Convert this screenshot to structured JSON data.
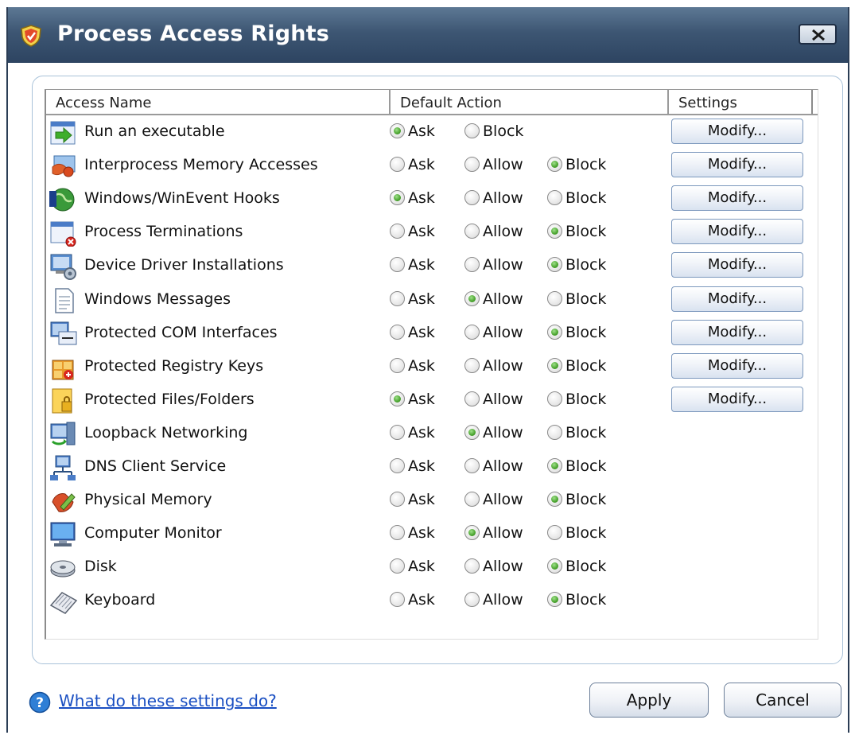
{
  "window": {
    "title": "Process Access Rights"
  },
  "table": {
    "headers": {
      "name": "Access Name",
      "action": "Default Action",
      "settings": "Settings"
    },
    "labels": {
      "ask": "Ask",
      "allow": "Allow",
      "block": "Block",
      "modify": "Modify..."
    },
    "rows": [
      {
        "name": "Run an executable",
        "icon": "run-executable-icon",
        "options": [
          "Ask",
          "Block"
        ],
        "selected": "Ask",
        "modify": true
      },
      {
        "name": "Interprocess Memory Accesses",
        "icon": "interprocess-memory-icon",
        "options": [
          "Ask",
          "Allow",
          "Block"
        ],
        "selected": "Block",
        "modify": true
      },
      {
        "name": "Windows/WinEvent Hooks",
        "icon": "hooks-icon",
        "options": [
          "Ask",
          "Allow",
          "Block"
        ],
        "selected": "Ask",
        "modify": true
      },
      {
        "name": "Process Terminations",
        "icon": "process-termination-icon",
        "options": [
          "Ask",
          "Allow",
          "Block"
        ],
        "selected": "Block",
        "modify": true
      },
      {
        "name": "Device Driver Installations",
        "icon": "device-driver-icon",
        "options": [
          "Ask",
          "Allow",
          "Block"
        ],
        "selected": "Block",
        "modify": true
      },
      {
        "name": "Windows Messages",
        "icon": "windows-messages-icon",
        "options": [
          "Ask",
          "Allow",
          "Block"
        ],
        "selected": "Allow",
        "modify": true
      },
      {
        "name": "Protected COM Interfaces",
        "icon": "com-interfaces-icon",
        "options": [
          "Ask",
          "Allow",
          "Block"
        ],
        "selected": "Block",
        "modify": true
      },
      {
        "name": "Protected Registry Keys",
        "icon": "registry-keys-icon",
        "options": [
          "Ask",
          "Allow",
          "Block"
        ],
        "selected": "Block",
        "modify": true
      },
      {
        "name": "Protected Files/Folders",
        "icon": "files-folders-icon",
        "options": [
          "Ask",
          "Allow",
          "Block"
        ],
        "selected": "Ask",
        "modify": true
      },
      {
        "name": "Loopback Networking",
        "icon": "loopback-networking-icon",
        "options": [
          "Ask",
          "Allow",
          "Block"
        ],
        "selected": "Allow",
        "modify": false
      },
      {
        "name": "DNS Client Service",
        "icon": "dns-client-icon",
        "options": [
          "Ask",
          "Allow",
          "Block"
        ],
        "selected": "Block",
        "modify": false
      },
      {
        "name": "Physical Memory",
        "icon": "physical-memory-icon",
        "options": [
          "Ask",
          "Allow",
          "Block"
        ],
        "selected": "Block",
        "modify": false
      },
      {
        "name": "Computer Monitor",
        "icon": "computer-monitor-icon",
        "options": [
          "Ask",
          "Allow",
          "Block"
        ],
        "selected": "Allow",
        "modify": false
      },
      {
        "name": "Disk",
        "icon": "disk-icon",
        "options": [
          "Ask",
          "Allow",
          "Block"
        ],
        "selected": "Block",
        "modify": false
      },
      {
        "name": "Keyboard",
        "icon": "keyboard-icon",
        "options": [
          "Ask",
          "Allow",
          "Block"
        ],
        "selected": "Block",
        "modify": false
      }
    ]
  },
  "footer": {
    "help_link": "What do these settings do?",
    "apply": "Apply",
    "cancel": "Cancel"
  },
  "colors": {
    "titlebar": "#3d5673",
    "radio_selected": "#4aa42f",
    "link": "#1a4fc2"
  }
}
